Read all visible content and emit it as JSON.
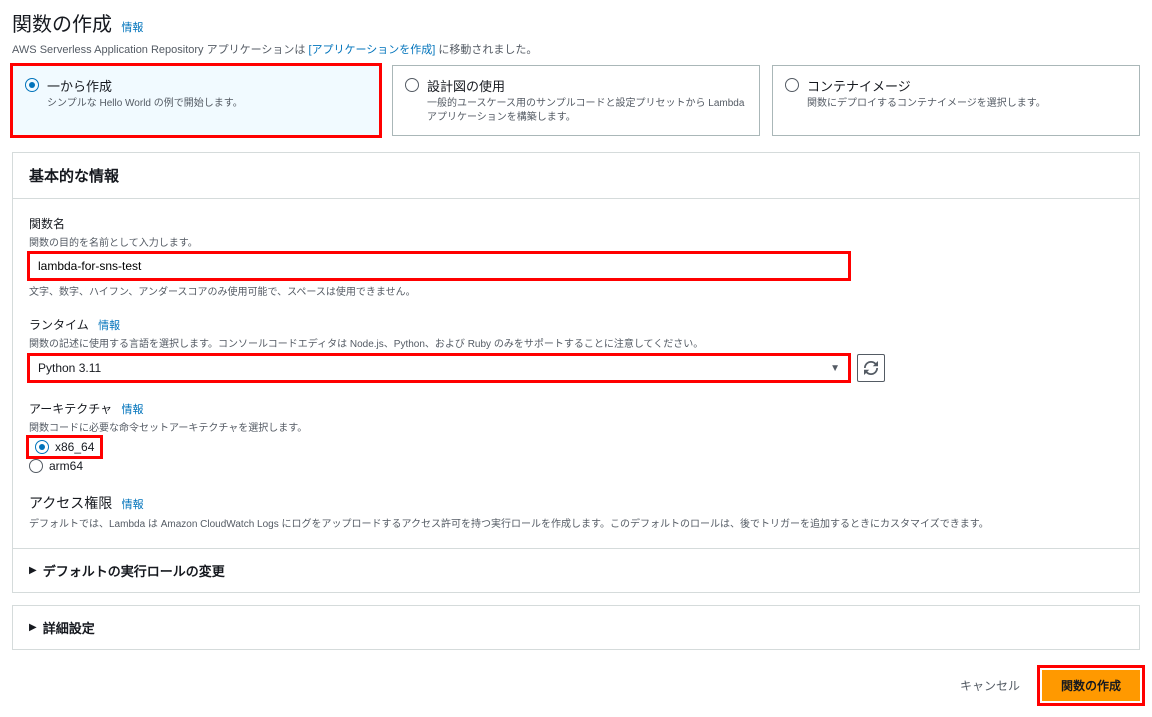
{
  "header": {
    "title": "関数の作成",
    "info": "情報",
    "subtitle_before": "AWS Serverless Application Repository アプリケーションは ",
    "subtitle_link": "[アプリケーションを作成]",
    "subtitle_after": " に移動されました。"
  },
  "options": [
    {
      "title": "一から作成",
      "desc": "シンプルな Hello World の例で開始します。",
      "selected": true
    },
    {
      "title": "設計図の使用",
      "desc": "一般的ユースケース用のサンプルコードと設定プリセットから Lambda アプリケーションを構築します。",
      "selected": false
    },
    {
      "title": "コンテナイメージ",
      "desc": "関数にデプロイするコンテナイメージを選択します。",
      "selected": false
    }
  ],
  "basic": {
    "title": "基本的な情報",
    "function_name": {
      "label": "関数名",
      "hint": "関数の目的を名前として入力します。",
      "value": "lambda-for-sns-test",
      "below": "文字、数字、ハイフン、アンダースコアのみ使用可能で、スペースは使用できません。"
    },
    "runtime": {
      "label": "ランタイム",
      "info": "情報",
      "hint": "関数の記述に使用する言語を選択します。コンソールコードエディタは Node.js、Python、および Ruby のみをサポートすることに注意してください。",
      "value": "Python 3.11"
    },
    "architecture": {
      "label": "アーキテクチャ",
      "info": "情報",
      "hint": "関数コードに必要な命令セットアーキテクチャを選択します。",
      "options": [
        {
          "label": "x86_64",
          "selected": true
        },
        {
          "label": "arm64",
          "selected": false
        }
      ]
    },
    "permissions": {
      "title": "アクセス権限",
      "info": "情報",
      "desc": "デフォルトでは、Lambda は Amazon CloudWatch Logs にログをアップロードするアクセス許可を持つ実行ロールを作成します。このデフォルトのロールは、後でトリガーを追加するときにカスタマイズできます。"
    },
    "role_expander": "デフォルトの実行ロールの変更"
  },
  "advanced": {
    "title": "詳細設定"
  },
  "footer": {
    "cancel": "キャンセル",
    "create": "関数の作成"
  }
}
